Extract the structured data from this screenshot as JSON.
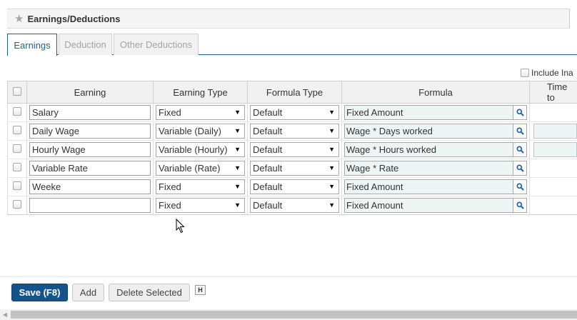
{
  "panel": {
    "title": "Earnings/Deductions",
    "icon": "star-icon"
  },
  "tabs": [
    {
      "label": "Earnings",
      "active": true
    },
    {
      "label": "Deduction",
      "active": false
    },
    {
      "label": "Other Deductions",
      "active": false
    }
  ],
  "include_inactive": {
    "label": "Include Ina",
    "checked": false
  },
  "grid": {
    "headers": [
      "Earning",
      "Earning Type",
      "Formula Type",
      "Formula",
      "Time to"
    ],
    "rows": [
      {
        "earning": "Salary",
        "earning_type": "Fixed",
        "formula_type": "Default",
        "formula": "Fixed Amount",
        "has_time": false
      },
      {
        "earning": "Daily Wage",
        "earning_type": "Variable (Daily)",
        "formula_type": "Default",
        "formula": "Wage * Days worked",
        "has_time": true
      },
      {
        "earning": "Hourly Wage",
        "earning_type": "Variable (Hourly)",
        "formula_type": "Default",
        "formula": "Wage * Hours worked",
        "has_time": true
      },
      {
        "earning": "Variable Rate",
        "earning_type": "Variable (Rate)",
        "formula_type": "Default",
        "formula": "Wage * Rate",
        "has_time": false
      },
      {
        "earning": "Weeke",
        "earning_type": "Fixed",
        "formula_type": "Default",
        "formula": "Fixed Amount",
        "has_time": false
      },
      {
        "earning": "",
        "earning_type": "Fixed",
        "formula_type": "Default",
        "formula": "Fixed Amount",
        "has_time": false
      }
    ]
  },
  "footer": {
    "save_label": "Save (F8)",
    "add_label": "Add",
    "delete_label": "Delete Selected",
    "h_badge": "H"
  },
  "colors": {
    "primary": "#15548b",
    "tab_active": "#1d6493",
    "formula_bg": "#eef5f5"
  }
}
